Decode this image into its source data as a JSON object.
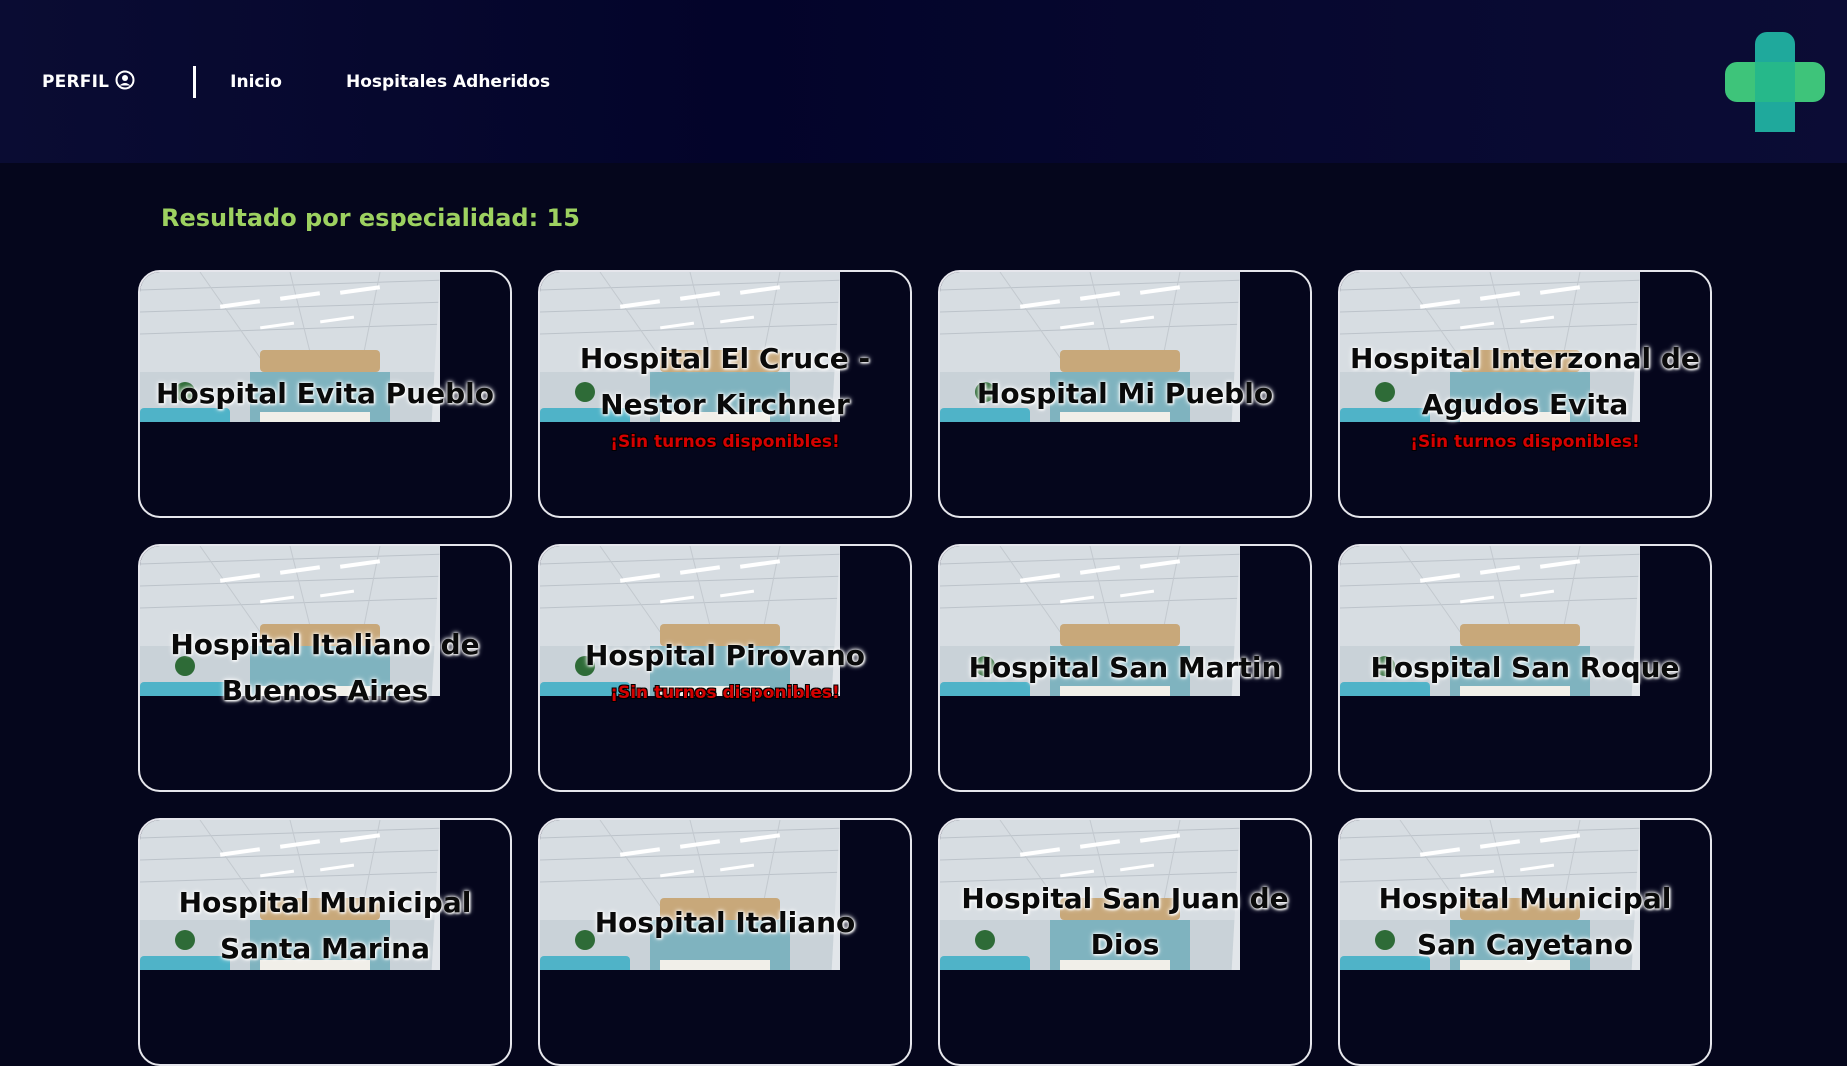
{
  "nav": {
    "profile_label": "PERFIL",
    "links": [
      "Inicio",
      "Hospitales Adheridos"
    ]
  },
  "icons": {
    "profile": "user-circle-icon",
    "logo": "medical-cross-logo"
  },
  "colors": {
    "background": "#05061c",
    "header": "#0a0c33",
    "accent_green": "#9dd160",
    "badge_red": "#d40000",
    "logo_green": "#3ec47a",
    "logo_teal": "#1fa99c"
  },
  "results": {
    "title": "Resultado por especialidad: 15"
  },
  "hospitals": [
    {
      "name": "Hospital Evita Pueblo",
      "badge": ""
    },
    {
      "name": "Hospital El Cruce - Nestor Kirchner",
      "badge": "¡Sin turnos disponibles!"
    },
    {
      "name": "Hospital Mi Pueblo",
      "badge": ""
    },
    {
      "name": "Hospital Interzonal de Agudos Evita",
      "badge": "¡Sin turnos disponibles!"
    },
    {
      "name": "Hospital Italiano de Buenos Aires",
      "badge": ""
    },
    {
      "name": "Hospital Pirovano",
      "badge": "¡Sin turnos disponibles!"
    },
    {
      "name": "Hospital San Martin",
      "badge": ""
    },
    {
      "name": "Hospital San Roque",
      "badge": ""
    },
    {
      "name": "Hospital Municipal Santa Marina",
      "badge": ""
    },
    {
      "name": "Hospital Italiano",
      "badge": ""
    },
    {
      "name": "Hospital San Juan de Dios",
      "badge": ""
    },
    {
      "name": "Hospital Municipal San Cayetano",
      "badge": ""
    }
  ]
}
